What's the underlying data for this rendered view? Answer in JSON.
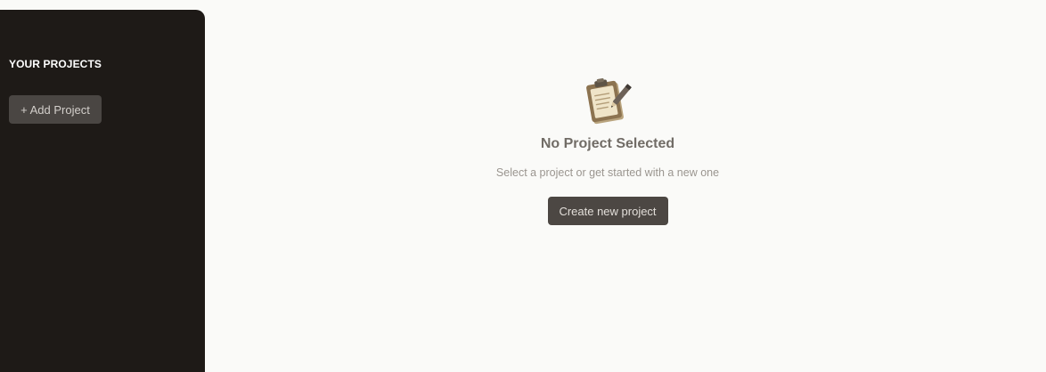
{
  "sidebar": {
    "heading": "YOUR PROJECTS",
    "add_project_label": "+ Add Project"
  },
  "main": {
    "empty_state": {
      "icon": "clipboard-pencil-icon",
      "title": "No Project Selected",
      "subtitle": "Select a project or get started with a new one",
      "create_button_label": "Create new project"
    }
  },
  "colors": {
    "sidebar_bg": "#1e1a17",
    "main_bg": "#fafaf8",
    "button_bg": "#4c4743",
    "title_text": "#716c66",
    "subtitle_text": "#9a958f"
  }
}
